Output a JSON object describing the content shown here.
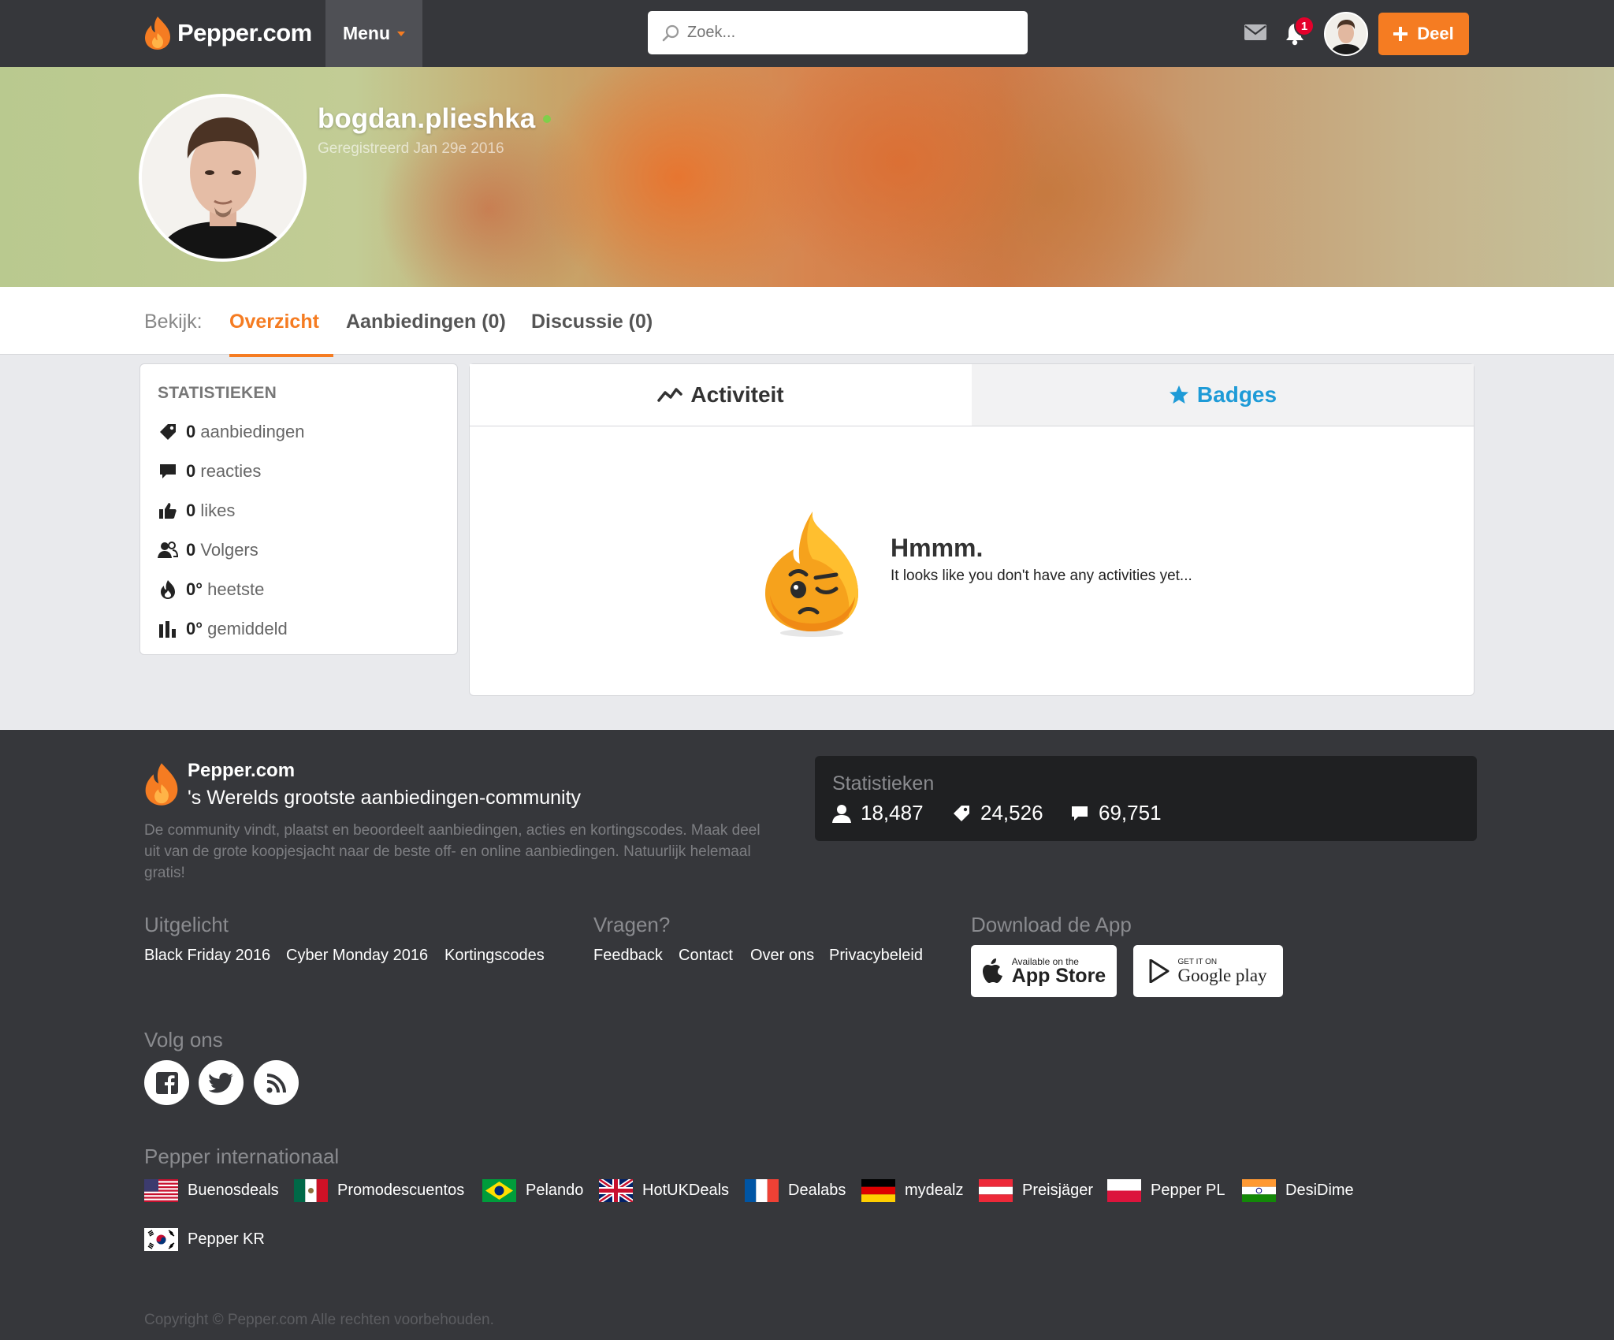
{
  "header": {
    "logo_text": "Pepper.com",
    "menu_label": "Menu",
    "search_placeholder": "Zoek...",
    "notification_count": "1",
    "share_label": "Deel",
    "colors": {
      "bar": "#36373b",
      "accent": "#f57c22"
    }
  },
  "profile": {
    "username": "bogdan.plieshka",
    "registered": "Geregistreerd Jan 29e 2016",
    "online": true
  },
  "tabs": {
    "label": "Bekijk:",
    "items": [
      {
        "label": "Overzicht",
        "active": true
      },
      {
        "label": "Aanbiedingen (0)",
        "active": false
      },
      {
        "label": "Discussie (0)",
        "active": false
      }
    ]
  },
  "stats": {
    "title": "STATISTIEKEN",
    "rows": [
      {
        "icon": "tag-icon",
        "value": "0",
        "label": "aanbiedingen"
      },
      {
        "icon": "comment-icon",
        "value": "0",
        "label": "reacties"
      },
      {
        "icon": "thumbs-up-icon",
        "value": "0",
        "label": "likes"
      },
      {
        "icon": "followers-icon",
        "value": "0",
        "label": "Volgers"
      },
      {
        "icon": "flame-icon",
        "value": "0°",
        "label": "heetste"
      },
      {
        "icon": "bar-chart-icon",
        "value": "0°",
        "label": "gemiddeld"
      }
    ]
  },
  "activity": {
    "tab_activity": "Activiteit",
    "tab_badges": "Badges",
    "empty_title": "Hmmm.",
    "empty_message": "It looks like you don't have any activities yet..."
  },
  "footer": {
    "brand": "Pepper.com",
    "slogan": "'s Werelds grootste aanbiedingen-community",
    "description": "De community vindt, plaatst en beoordeelt aanbiedingen, acties en kortingscodes. Maak deel uit van de grote koopjesjacht naar de beste off- en online aanbiedingen. Natuurlijk helemaal gratis!",
    "stats_title": "Statistieken",
    "stats": [
      {
        "icon": "user-icon",
        "value": "18,487"
      },
      {
        "icon": "tag-icon",
        "value": "24,526"
      },
      {
        "icon": "comment-icon",
        "value": "69,751"
      }
    ],
    "featured_title": "Uitgelicht",
    "featured_links": [
      "Black Friday 2016",
      "Cyber Monday 2016",
      "Kortingscodes"
    ],
    "questions_title": "Vragen?",
    "questions_links": [
      "Feedback",
      "Contact",
      "Over ons",
      "Privacybeleid"
    ],
    "app_title": "Download de App",
    "appstore_small": "Available on the",
    "appstore_big": "App Store",
    "googleplay_small": "GET IT ON",
    "googleplay_big": "Google play",
    "follow_title": "Volg ons",
    "social": [
      "facebook-icon",
      "twitter-icon",
      "rss-icon"
    ],
    "intl_title": "Pepper internationaal",
    "intl_sites": [
      {
        "name": "Buenosdeals",
        "flag": "us"
      },
      {
        "name": "Promodescuentos",
        "flag": "mx"
      },
      {
        "name": "Pelando",
        "flag": "br"
      },
      {
        "name": "HotUKDeals",
        "flag": "uk"
      },
      {
        "name": "Dealabs",
        "flag": "fr"
      },
      {
        "name": "mydealz",
        "flag": "de"
      },
      {
        "name": "Preisjäger",
        "flag": "at"
      },
      {
        "name": "Pepper PL",
        "flag": "pl"
      },
      {
        "name": "DesiDime",
        "flag": "in"
      },
      {
        "name": "Pepper KR",
        "flag": "kr"
      }
    ],
    "copyright": "Copyright © Pepper.com Alle rechten voorbehouden."
  }
}
